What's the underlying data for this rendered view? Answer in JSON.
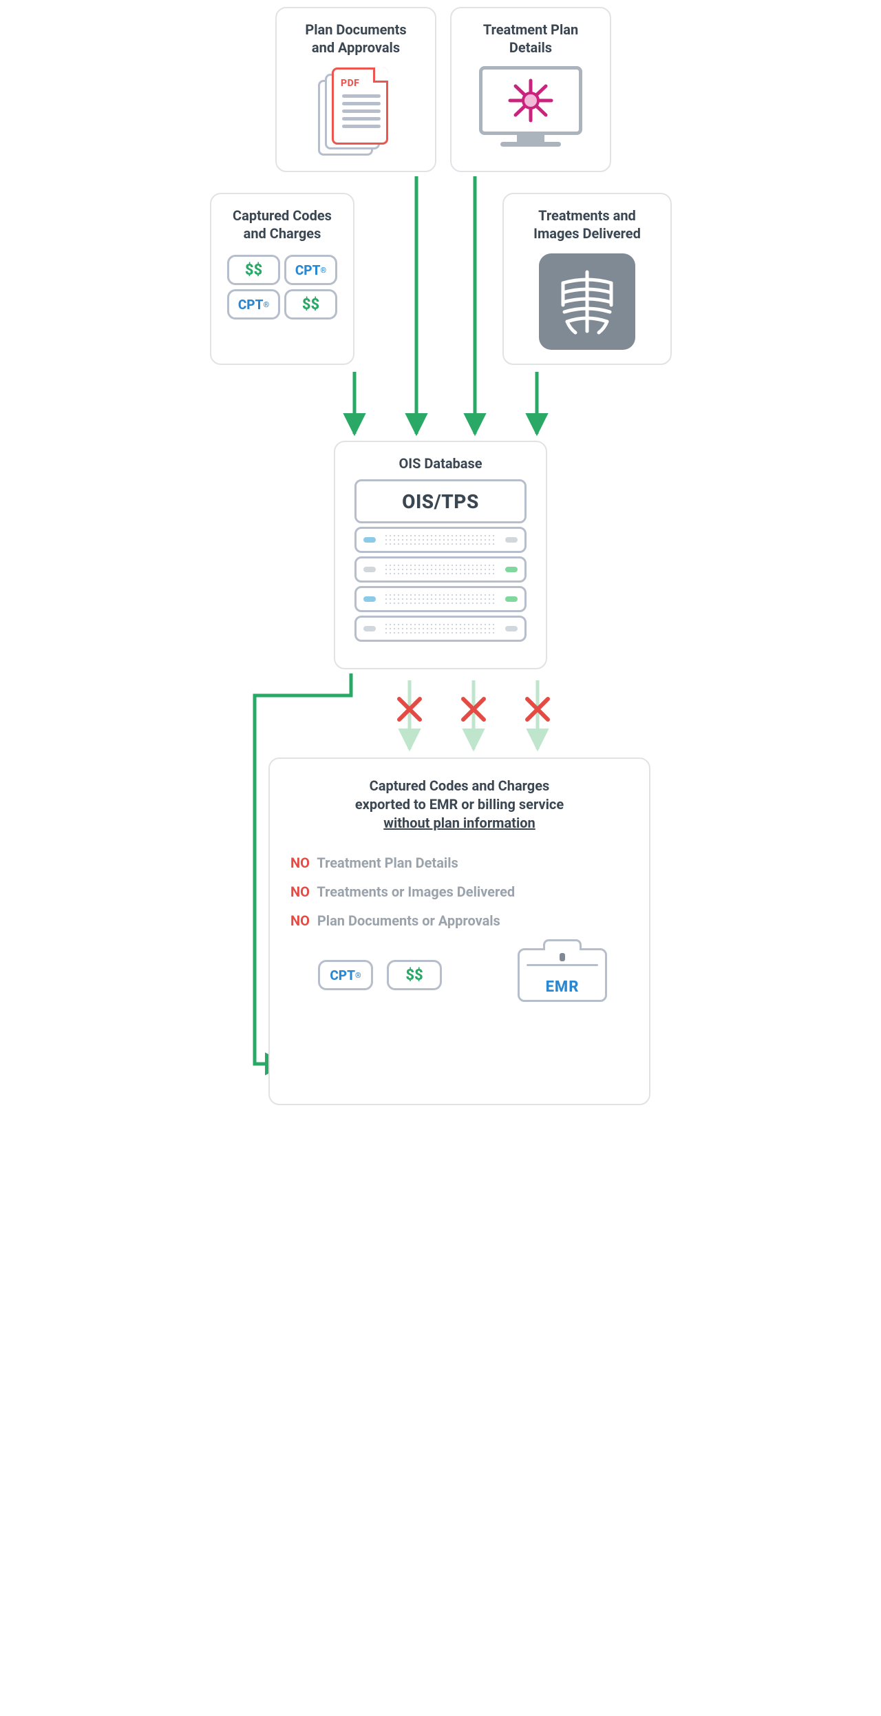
{
  "boxes": {
    "plan_docs": {
      "title_l1": "Plan Documents",
      "title_l2": "and Approvals",
      "pdf_label": "PDF"
    },
    "treatment_plan": {
      "title_l1": "Treatment Plan",
      "title_l2": "Details"
    },
    "captured_codes": {
      "title_l1": "Captured Codes",
      "title_l2": "and Charges"
    },
    "treatments_images": {
      "title_l1": "Treatments and",
      "title_l2": "Images Delivered"
    },
    "ois": {
      "title": "OIS Database",
      "server_label": "OIS/TPS"
    }
  },
  "pills": {
    "money": "$$",
    "cpt": "CPT",
    "cpt_reg": "®"
  },
  "bottom": {
    "headline_l1": "Captured Codes and Charges",
    "headline_l2": "exported to EMR or billing service",
    "headline_l3_underlined": "without plan information",
    "no_label": "NO",
    "no1": "Treatment Plan Details",
    "no2": "Treatments or Images Delivered",
    "no3": "Plan Documents or Approvals",
    "emr_label": "EMR"
  },
  "colors": {
    "green": "#2aa866",
    "red": "#e34b44",
    "light_green": "#bfe6cd",
    "grey": "#b7becb",
    "blue": "#2a87d1",
    "magenta": "#c9237e"
  }
}
